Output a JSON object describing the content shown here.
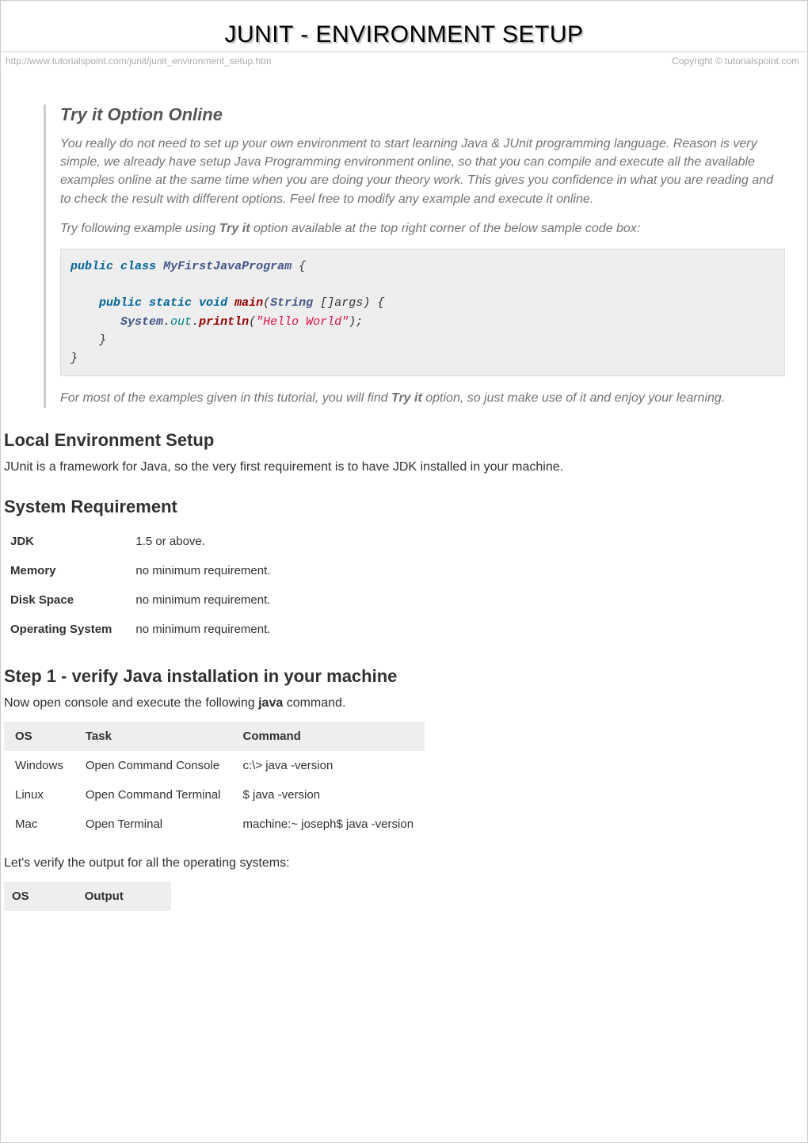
{
  "title": "JUNIT - ENVIRONMENT SETUP",
  "meta": {
    "url": "http://www.tutorialspoint.com/junit/junit_environment_setup.htm",
    "copyright": "Copyright © tutorialspoint.com"
  },
  "tryit": {
    "heading": "Try it Option Online",
    "para1": "You really do not need to set up your own environment to start learning Java & JUnit programming language. Reason is very simple, we already have setup Java Programming environment online, so that you can compile and execute all the available examples online at the same time when you are doing your theory work. This gives you confidence in what you are reading and to check the result with different options. Feel free to modify any example and execute it online.",
    "para2_pre": "Try following example using ",
    "para2_bold": "Try it",
    "para2_post": " option available at the top right corner of the below sample code box:",
    "code": {
      "kw_public": "public",
      "kw_class": "class",
      "cls": "MyFirstJavaProgram",
      "brace_open": "{",
      "kw_static": "static",
      "kw_void": "void",
      "fn": "main",
      "paren_open": "(",
      "type": "String",
      "arr": "[]",
      "arg": "args",
      "paren_close": ")",
      "sys": "System",
      "dot": ".",
      "out": "out",
      "println": "println",
      "str": "\"Hello World\"",
      "close_paren": ");",
      "brace_close": "}"
    },
    "para3_pre": "For most of the examples given in this tutorial, you will find ",
    "para3_bold": "Try it",
    "para3_post": " option, so just make use of it and enjoy your learning."
  },
  "sections": {
    "local_env": {
      "heading": "Local Environment Setup",
      "text": "JUnit is a framework for Java, so the very first requirement is to have JDK installed in your machine."
    },
    "sys_req": {
      "heading": "System Requirement",
      "rows": [
        {
          "label": "JDK",
          "value": "1.5 or above."
        },
        {
          "label": "Memory",
          "value": "no minimum requirement."
        },
        {
          "label": "Disk Space",
          "value": "no minimum requirement."
        },
        {
          "label": "Operating System",
          "value": "no minimum requirement."
        }
      ]
    },
    "step1": {
      "heading": "Step 1 - verify Java installation in your machine",
      "text_pre": "Now open console and execute the following ",
      "text_bold": "java",
      "text_post": " command.",
      "headers": {
        "os": "OS",
        "task": "Task",
        "command": "Command"
      },
      "rows": [
        {
          "os": "Windows",
          "task": "Open Command Console",
          "cmd": "c:\\> java -version"
        },
        {
          "os": "Linux",
          "task": "Open Command Terminal",
          "cmd": "$ java -version"
        },
        {
          "os": "Mac",
          "task": "Open Terminal",
          "cmd": "machine:~ joseph$ java -version"
        }
      ],
      "verify_text": "Let's verify the output for all the operating systems:",
      "out_headers": {
        "os": "OS",
        "output": "Output"
      }
    }
  }
}
